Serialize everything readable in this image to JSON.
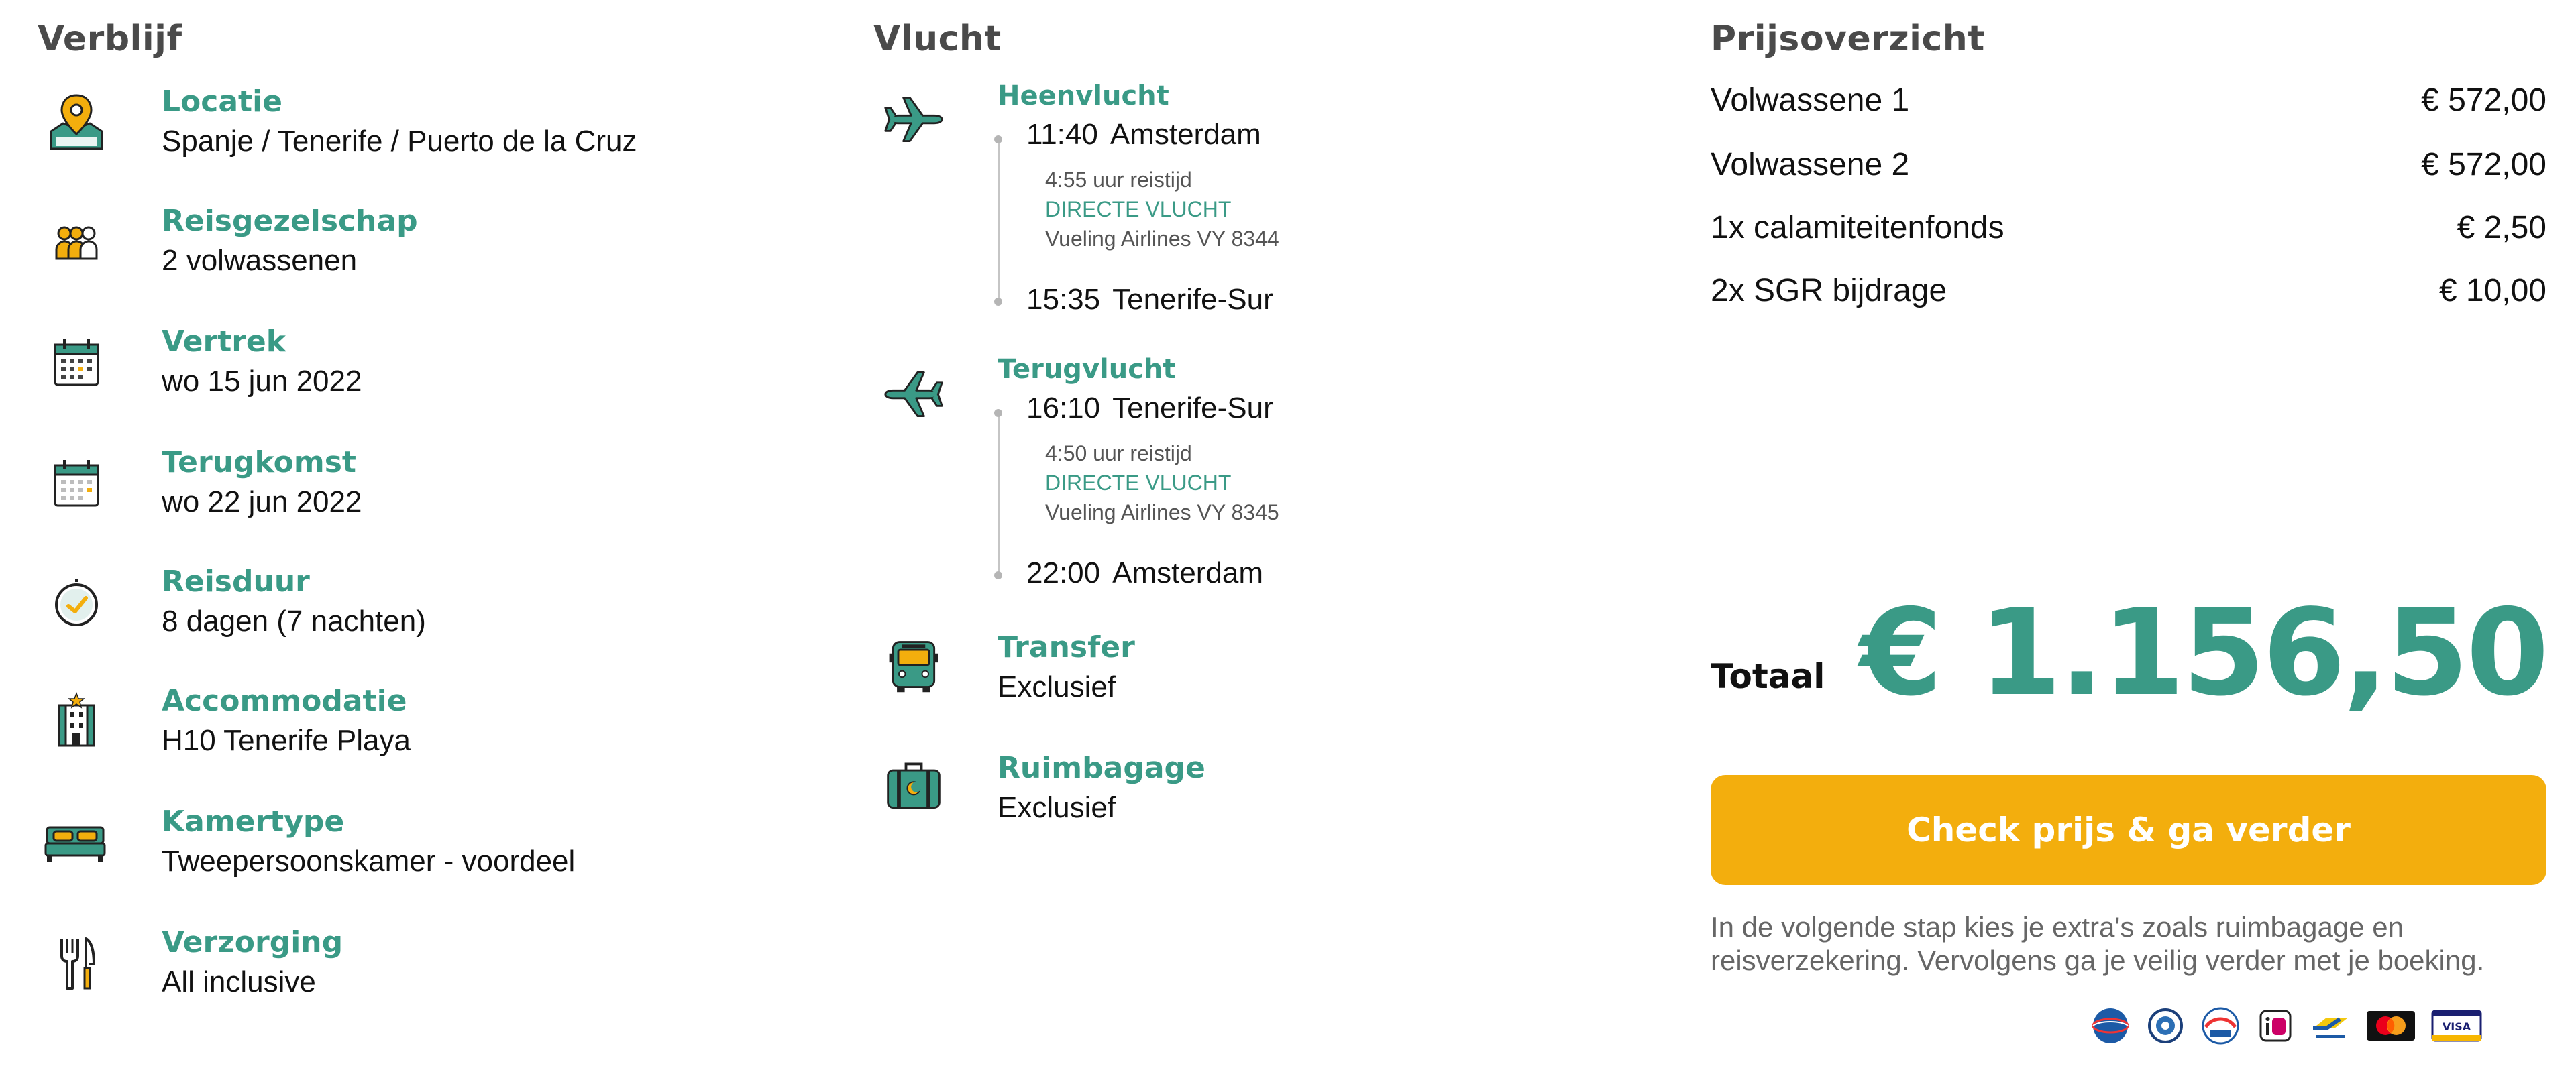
{
  "verblijf": {
    "title": "Verblijf",
    "items": [
      {
        "label": "Locatie",
        "value": "Spanje / Tenerife / Puerto de la Cruz",
        "icon": "location-pin-map-icon"
      },
      {
        "label": "Reisgezelschap",
        "value": "2 volwassenen",
        "icon": "group-people-icon"
      },
      {
        "label": "Vertrek",
        "value": "wo 15 jun 2022",
        "icon": "calendar-icon"
      },
      {
        "label": "Terugkomst",
        "value": "wo 22 jun 2022",
        "icon": "calendar-icon"
      },
      {
        "label": "Reisduur",
        "value": "8 dagen (7 nachten)",
        "icon": "clock-icon"
      },
      {
        "label": "Accommodatie",
        "value": "H10 Tenerife Playa",
        "icon": "hotel-icon"
      },
      {
        "label": "Kamertype",
        "value": "Tweepersoonskamer - voordeel",
        "icon": "bed-icon"
      },
      {
        "label": "Verzorging",
        "value": "All inclusive",
        "icon": "cutlery-icon"
      }
    ]
  },
  "vlucht": {
    "title": "Vlucht",
    "heen": {
      "title": "Heenvlucht",
      "depart_time": "11:40",
      "depart_city": "Amsterdam",
      "duration": "4:55 uur reistijd",
      "type": "DIRECTE VLUCHT",
      "carrier": "Vueling Airlines VY 8344",
      "arrive_time": "15:35",
      "arrive_city": "Tenerife-Sur"
    },
    "terug": {
      "title": "Terugvlucht",
      "depart_time": "16:10",
      "depart_city": "Tenerife-Sur",
      "duration": "4:50 uur reistijd",
      "type": "DIRECTE VLUCHT",
      "carrier": "Vueling Airlines VY 8345",
      "arrive_time": "22:00",
      "arrive_city": "Amsterdam"
    },
    "transfer": {
      "label": "Transfer",
      "value": "Exclusief",
      "icon": "bus-icon"
    },
    "ruimbagage": {
      "label": "Ruimbagage",
      "value": "Exclusief",
      "icon": "suitcase-icon"
    }
  },
  "prijs": {
    "title": "Prijsoverzicht",
    "rows": [
      {
        "label": "Volwassene 1",
        "value": "€ 572,00"
      },
      {
        "label": "Volwassene 2",
        "value": "€ 572,00"
      },
      {
        "label": "1x calamiteitenfonds",
        "value": "€ 2,50"
      },
      {
        "label": "2x SGR bijdrage",
        "value": "€ 10,00"
      }
    ],
    "total_label": "Totaal",
    "total_value": "€ 1.156,50",
    "cta_label": "Check prijs & ga verder",
    "note": "In de volgende stap kies je extra's zoals ruimbagage en reisverzekering. Vervolgens ga je veilig verder met je boeking.",
    "payment_logos": [
      "ANVR",
      "Geschillencommissie",
      "SGR",
      "iDEAL",
      "Bancontact",
      "Mastercard",
      "VISA"
    ]
  },
  "colors": {
    "teal": "#3a9a86",
    "yellow": "#f3ae0d",
    "heading": "#4a4a4a"
  }
}
